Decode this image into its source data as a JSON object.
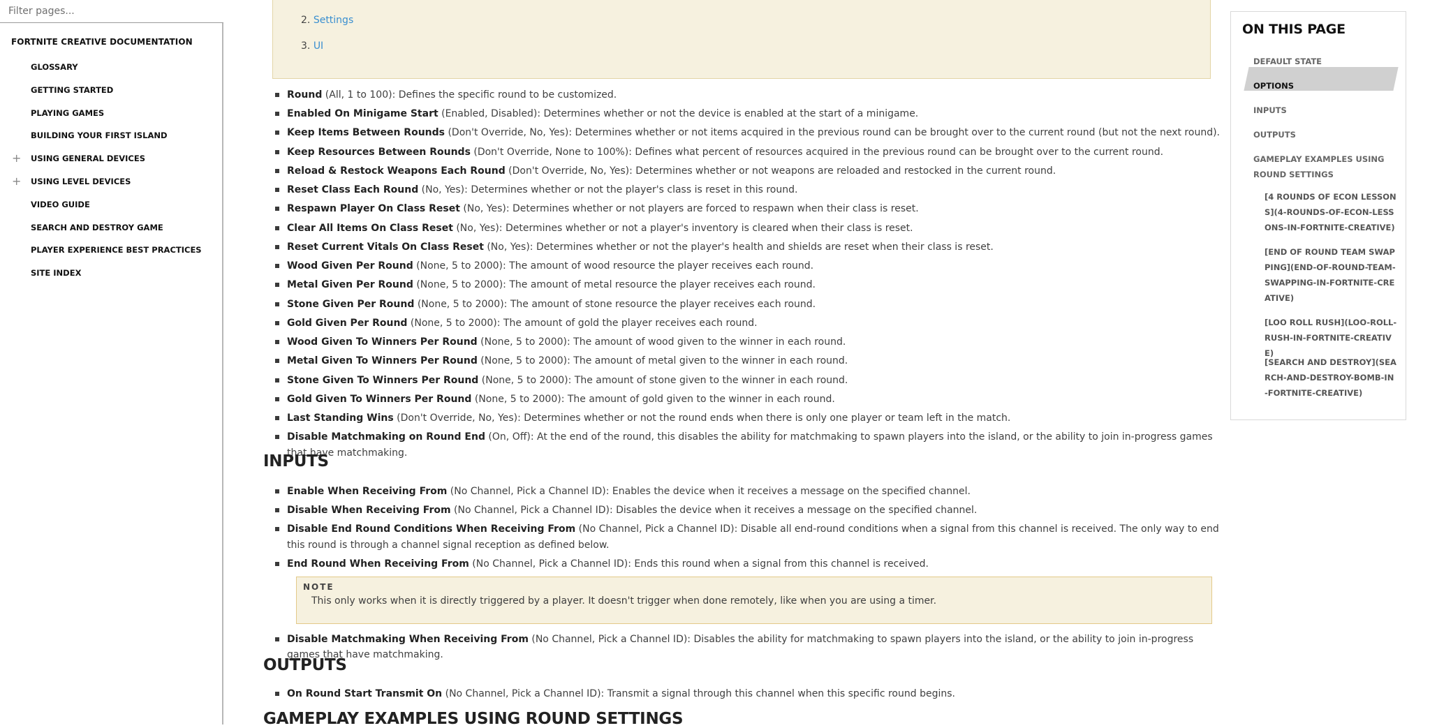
{
  "sidebar": {
    "filter_placeholder": "Filter pages...",
    "root": "FORTNITE CREATIVE DOCUMENTATION",
    "items": [
      {
        "label": "GLOSSARY",
        "expandable": false
      },
      {
        "label": "GETTING STARTED",
        "expandable": false
      },
      {
        "label": "PLAYING GAMES",
        "expandable": false
      },
      {
        "label": "BUILDING YOUR FIRST ISLAND",
        "expandable": false
      },
      {
        "label": "USING GENERAL DEVICES",
        "expandable": true
      },
      {
        "label": "USING LEVEL DEVICES",
        "expandable": true
      },
      {
        "label": "VIDEO GUIDE",
        "expandable": false
      },
      {
        "label": "SEARCH AND DESTROY GAME",
        "expandable": false
      },
      {
        "label": "PLAYER EXPERIENCE BEST PRACTICES",
        "expandable": false
      },
      {
        "label": "SITE INDEX",
        "expandable": false
      }
    ],
    "expand_glyph": "+"
  },
  "toc": {
    "items": [
      {
        "num": "2.",
        "label": "Settings"
      },
      {
        "num": "3.",
        "label": "UI"
      }
    ]
  },
  "options": [
    {
      "name": "Round",
      "desc": " (All, 1 to 100): Defines the specific round to be customized."
    },
    {
      "name": "Enabled On Minigame Start",
      "desc": " (Enabled, Disabled): Determines whether or not the device is enabled at the start of a minigame."
    },
    {
      "name": "Keep Items Between Rounds",
      "desc": " (Don't Override, No, Yes): Determines whether or not items acquired in the previous round can be brought over to the current round (but not the next round)."
    },
    {
      "name": "Keep Resources Between Rounds",
      "desc": " (Don't Override, None to 100%): Defines what percent of resources acquired in the previous round can be brought over to the current round."
    },
    {
      "name": "Reload & Restock Weapons Each Round",
      "desc": " (Don't Override, No, Yes): Determines whether or not weapons are reloaded and restocked in the current round."
    },
    {
      "name": "Reset Class Each Round",
      "desc": " (No, Yes): Determines whether or not the player's class is reset in this round."
    },
    {
      "name": "Respawn Player On Class Reset",
      "desc": " (No, Yes): Determines whether or not players are forced to respawn when their class is reset."
    },
    {
      "name": "Clear All Items On Class Reset",
      "desc": " (No, Yes): Determines whether or not a player's inventory is cleared when their class is reset."
    },
    {
      "name": "Reset Current Vitals On Class Reset",
      "desc": " (No, Yes): Determines whether or not the player's health and shields are reset when their class is reset."
    },
    {
      "name": "Wood Given Per Round",
      "desc": " (None, 5 to 2000): The amount of wood resource the player receives each round."
    },
    {
      "name": "Metal Given Per Round",
      "desc": " (None, 5 to 2000): The amount of metal resource the player receives each round."
    },
    {
      "name": "Stone Given Per Round",
      "desc": " (None, 5 to 2000): The amount of stone resource the player receives each round."
    },
    {
      "name": "Gold Given Per Round",
      "desc": " (None, 5 to 2000): The amount of gold the player receives each round."
    },
    {
      "name": "Wood Given To Winners Per Round",
      "desc": " (None, 5 to 2000): The amount of wood given to the winner in each round."
    },
    {
      "name": "Metal Given To Winners Per Round",
      "desc": " (None, 5 to 2000): The amount of metal given to the winner in each round."
    },
    {
      "name": "Stone Given To Winners Per Round",
      "desc": " (None, 5 to 2000): The amount of stone given to the winner in each round."
    },
    {
      "name": "Gold Given To Winners Per Round",
      "desc": " (None, 5 to 2000): The amount of gold given to the winner in each round."
    },
    {
      "name": "Last Standing Wins",
      "desc": " (Don't Override, No, Yes): Determines whether or not the round ends when there is only one player or team left in the match."
    },
    {
      "name": "Disable Matchmaking on Round End",
      "desc": " (On, Off): At the end of the round, this disables the ability for matchmaking to spawn players into the island, or the ability to join in-progress games that have matchmaking."
    }
  ],
  "inputs": {
    "heading": "INPUTS",
    "items": [
      {
        "name": "Enable When Receiving From",
        "desc": " (No Channel, Pick a Channel ID): Enables the device when it receives a message on the specified channel."
      },
      {
        "name": "Disable When Receiving From",
        "desc": " (No Channel, Pick a Channel ID): Disables the device when it receives a message on the specified channel."
      },
      {
        "name": "Disable End Round Conditions When Receiving From",
        "desc": " (No Channel, Pick a Channel ID): Disable all end-round conditions when a signal from this channel is received. The only way to end this round is through a channel signal reception as defined below."
      },
      {
        "name": "End Round When Receiving From",
        "desc": " (No Channel, Pick a Channel ID): Ends this round when a signal from this channel is received."
      }
    ],
    "note_title": "NOTE",
    "note_text": "This only works when it is directly triggered by a player. It doesn't trigger when done remotely, like when you are using a timer.",
    "after_note": [
      {
        "name": "Disable Matchmaking When Receiving From",
        "desc": " (No Channel, Pick a Channel ID): Disables the ability for matchmaking to spawn players into the island, or the ability to join in-progress games that have matchmaking."
      }
    ]
  },
  "outputs": {
    "heading": "OUTPUTS",
    "items": [
      {
        "name": "On Round Start Transmit On",
        "desc": " (No Channel, Pick a Channel ID): Transmit a signal through this channel when this specific round begins."
      }
    ]
  },
  "gameplay_heading": "GAMEPLAY EXAMPLES USING ROUND SETTINGS",
  "on_this_page": {
    "title": "ON THIS PAGE",
    "items": [
      {
        "label": "DEFAULT STATE",
        "active": false
      },
      {
        "label": "OPTIONS",
        "active": true
      },
      {
        "label": "INPUTS",
        "active": false
      },
      {
        "label": "OUTPUTS",
        "active": false
      },
      {
        "label": "GAMEPLAY EXAMPLES USING ROUND SETTINGS",
        "active": false
      }
    ],
    "subitems": [
      {
        "label": "[4 ROUNDS OF ECON LESSONS](4-ROUNDS-OF-ECON-LESSONS-IN-FORTNITE-CREATIVE)"
      },
      {
        "label": "[END OF ROUND TEAM SWAPPING](END-OF-ROUND-TEAM-SWAPPING-IN-FORTNITE-CREATIVE)"
      },
      {
        "label": "[LOO ROLL RUSH](LOO-ROLL-RUSH-IN-FORTNITE-CREATIVE)"
      },
      {
        "label": "[SEARCH AND DESTROY](SEARCH-AND-DESTROY-BOMB-IN-FORTNITE-CREATIVE)"
      }
    ]
  }
}
